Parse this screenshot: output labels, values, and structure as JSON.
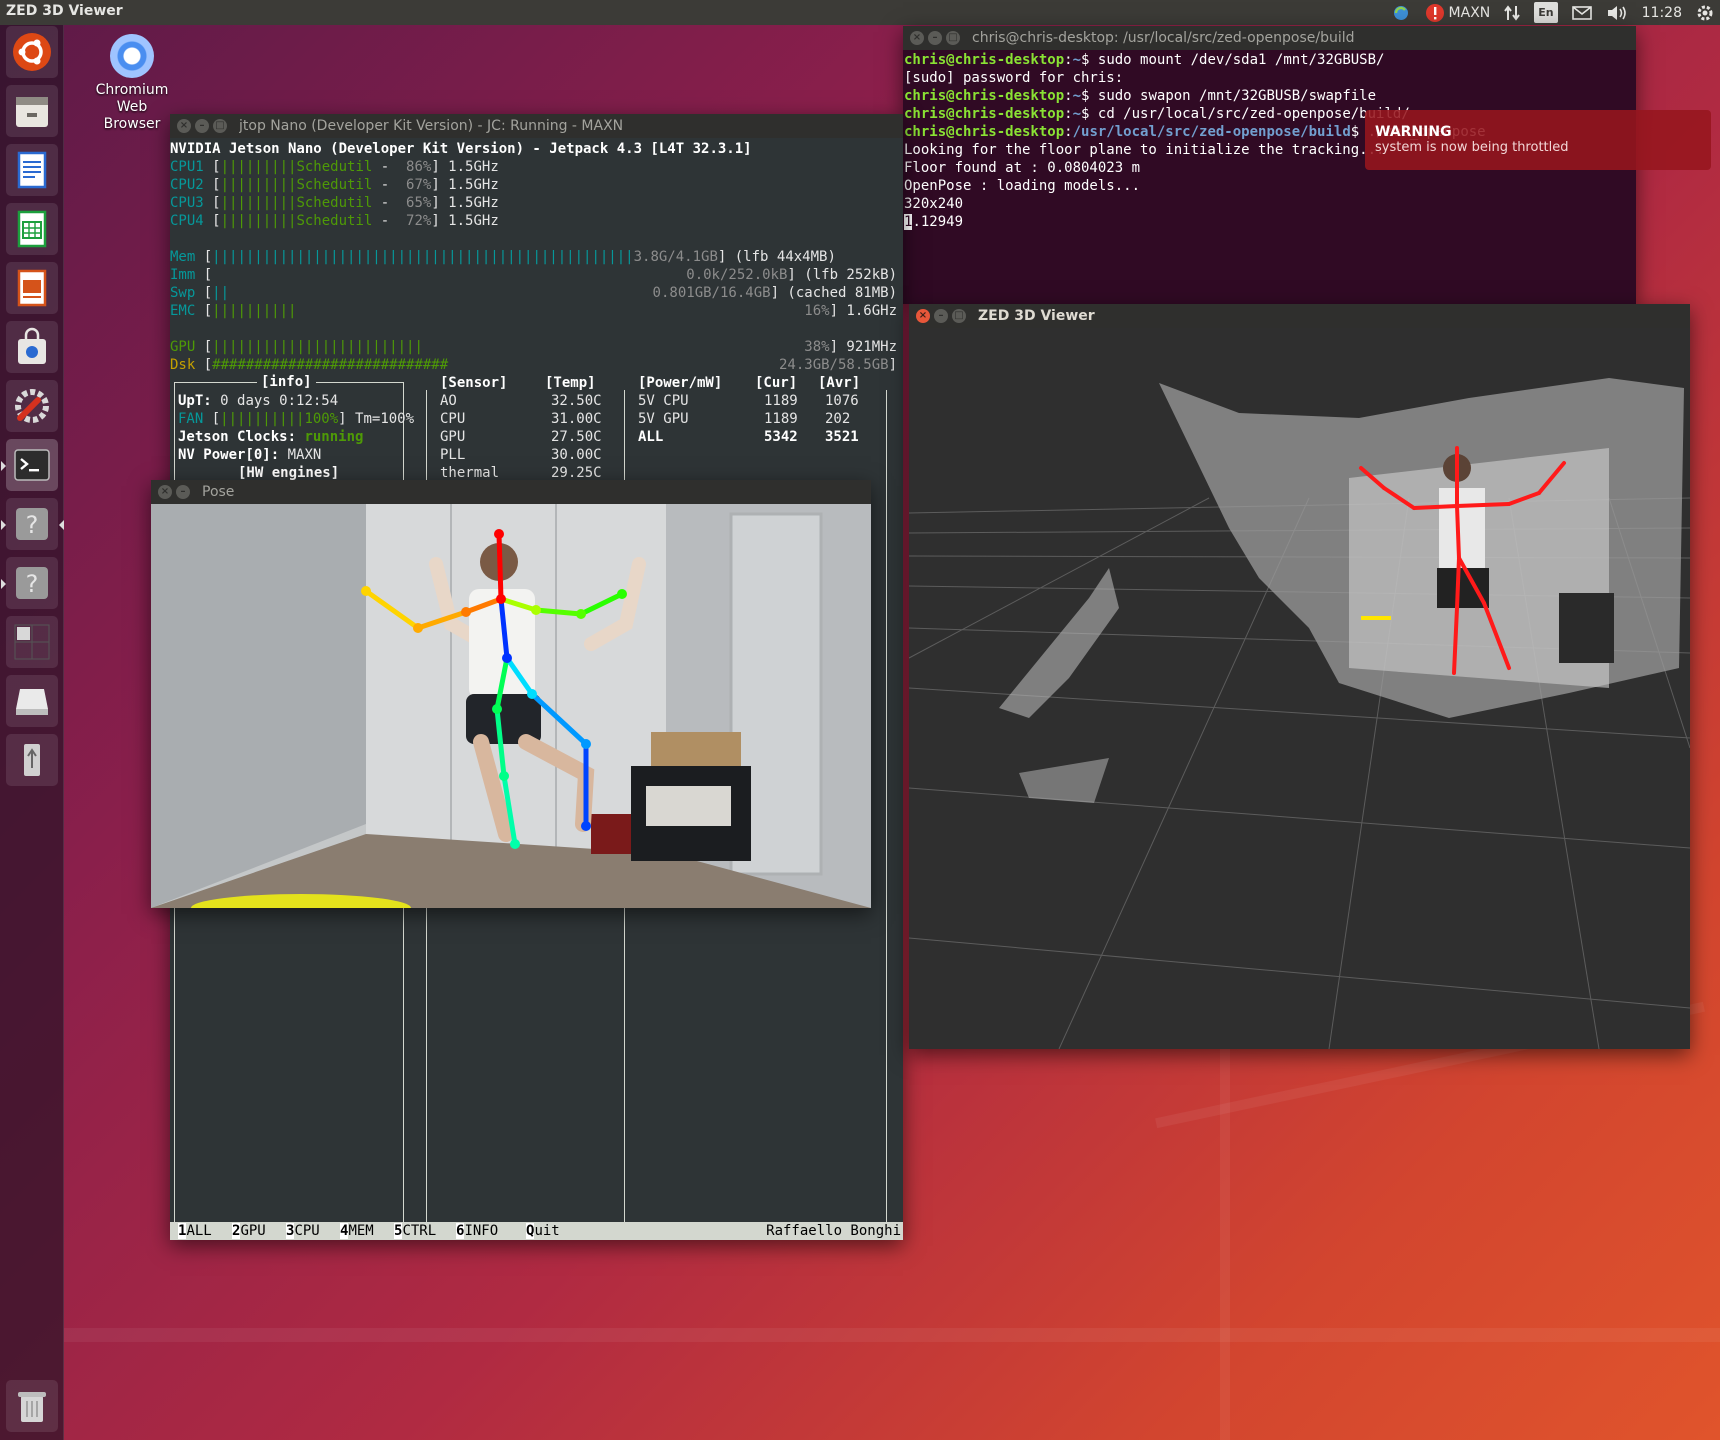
{
  "top_panel": {
    "active_app": "ZED 3D Viewer",
    "power_mode": "MAXN",
    "keyboard_lang": "En",
    "clock": "11:28"
  },
  "launcher": {
    "items": [
      {
        "name": "ubuntu-dash",
        "icon": "ubuntu-logo-icon"
      },
      {
        "name": "files",
        "icon": "file-cabinet-icon"
      },
      {
        "name": "libreoffice-writer",
        "icon": "writer-document-icon"
      },
      {
        "name": "libreoffice-calc",
        "icon": "calc-spreadsheet-icon"
      },
      {
        "name": "libreoffice-impress",
        "icon": "impress-slides-icon"
      },
      {
        "name": "ubuntu-software",
        "icon": "shopping-bag-icon"
      },
      {
        "name": "system-settings",
        "icon": "wrench-gear-icon"
      },
      {
        "name": "terminal",
        "icon": "terminal-icon"
      },
      {
        "name": "unknown-app-1",
        "icon": "question-mark-icon"
      },
      {
        "name": "unknown-app-2",
        "icon": "question-mark-icon"
      },
      {
        "name": "workspace-switcher",
        "icon": "workspaces-icon"
      },
      {
        "name": "removable-drive",
        "icon": "drive-icon"
      },
      {
        "name": "usb-device",
        "icon": "usb-icon"
      },
      {
        "name": "trash",
        "icon": "trash-icon"
      }
    ]
  },
  "desktop_icon": {
    "label_1": "Chromium",
    "label_2": "Web",
    "label_3": "Browser"
  },
  "notification": {
    "title": "WARNING",
    "body": "system is now being throttled"
  },
  "terminal": {
    "title": "chris@chris-desktop: /usr/local/src/zed-openpose/build",
    "prompt_user": "chris@chris-desktop",
    "lines": [
      {
        "path": "~",
        "cmd": "sudo mount /dev/sda1 /mnt/32GBUSB/"
      },
      {
        "out": "[sudo] password for chris:"
      },
      {
        "path": "~",
        "cmd": "sudo swapon /mnt/32GBUSB/swapfile"
      },
      {
        "path": "~",
        "cmd": "cd /usr/local/src/zed-openpose/build/"
      },
      {
        "path": "/usr/local/src/zed-openpose/build",
        "cmd": "./zed_openpose"
      },
      {
        "out": "Looking for the floor plane to initialize the tracking..."
      },
      {
        "out": "Floor found at : 0.0804023 m"
      },
      {
        "out": "OpenPose : loading models..."
      },
      {
        "out": "320x240"
      },
      {
        "out": "1.12949"
      }
    ]
  },
  "jtop": {
    "title": "jtop Nano (Developer Kit Version) - JC: Running - MAXN",
    "header": "NVIDIA Jetson Nano (Developer Kit Version) - Jetpack 4.3 [L4T 32.3.1]",
    "cpus": [
      {
        "label": "CPU1",
        "bar": "|||||||||",
        "governor": "Schedutil",
        "usage": "86%",
        "freq": "1.5GHz"
      },
      {
        "label": "CPU2",
        "bar": "|||||||||",
        "governor": "Schedutil",
        "usage": "67%",
        "freq": "1.5GHz"
      },
      {
        "label": "CPU3",
        "bar": "|||||||||",
        "governor": "Schedutil",
        "usage": "65%",
        "freq": "1.5GHz"
      },
      {
        "label": "CPU4",
        "bar": "|||||||||",
        "governor": "Schedutil",
        "usage": "72%",
        "freq": "1.5GHz"
      }
    ],
    "mem": {
      "label": "Mem",
      "bar": "||||||||||||||||||||||||||||||||||||||||||||||||||",
      "value": "3.8G/4.1GB",
      "extra": "(lfb 44x4MB)"
    },
    "imm": {
      "label": "Imm",
      "value": "0.0k/252.0kB",
      "extra": "(lfb 252kB)"
    },
    "swp": {
      "label": "Swp",
      "bar": "||",
      "value": "0.801GB/16.4GB",
      "extra": "(cached 81MB)"
    },
    "emc": {
      "label": "EMC",
      "bar": "||||||||||",
      "value": "16%",
      "extra": "1.6GHz"
    },
    "gpu": {
      "label": "GPU",
      "bar": "|||||||||||||||||||||||||",
      "value": "38%",
      "extra": "921MHz"
    },
    "dsk": {
      "label": "Dsk",
      "bar": "############################",
      "value": "24.3GB/58.5GB"
    },
    "info": {
      "title": "[info]",
      "uptime_label": "UpT:",
      "uptime": "0 days 0:12:54",
      "fan_label": "FAN",
      "fan_bar": "||||||||||",
      "fan_pct": "100%",
      "fan_tm": "Tm=100%",
      "clocks_label": "Jetson Clocks:",
      "clocks_value": "running",
      "power_label": "NV Power[0]:",
      "power_value": "MAXN",
      "hw_title": "[HW engines]"
    },
    "sensor": {
      "header_sensor": "[Sensor]",
      "header_temp": "[Temp]",
      "rows": [
        {
          "name": "AO",
          "temp": "32.50C"
        },
        {
          "name": "CPU",
          "temp": "31.00C"
        },
        {
          "name": "GPU",
          "temp": "27.50C"
        },
        {
          "name": "PLL",
          "temp": "30.00C"
        },
        {
          "name": "thermal",
          "temp": "29.25C"
        }
      ]
    },
    "power": {
      "header_power": "[Power/mW]",
      "header_cur": "[Cur]",
      "header_avr": "[Avr]",
      "rows": [
        {
          "name": "5V CPU",
          "cur": "1189",
          "avr": "1076"
        },
        {
          "name": "5V GPU",
          "cur": "1189",
          "avr": "202"
        },
        {
          "name": "ALL",
          "cur": "5342",
          "avr": "3521"
        }
      ]
    },
    "menu": [
      {
        "key": "1",
        "label": "ALL"
      },
      {
        "key": "2",
        "label": "GPU"
      },
      {
        "key": "3",
        "label": "CPU"
      },
      {
        "key": "4",
        "label": "MEM"
      },
      {
        "key": "5",
        "label": "CTRL"
      },
      {
        "key": "6",
        "label": "INFO"
      },
      {
        "key": "Q",
        "label": "uit"
      }
    ],
    "author": "Raffaello Bonghi"
  },
  "pose_window": {
    "title": "Pose"
  },
  "zed_window": {
    "title": "ZED 3D Viewer"
  },
  "colors": {
    "terminal_bg": "#300a24",
    "jtop_bg": "#2e3436",
    "prompt_green": "#8ae234",
    "prompt_blue": "#729fcf",
    "notification_red": "#96161e",
    "close_button": "#e8573a"
  }
}
